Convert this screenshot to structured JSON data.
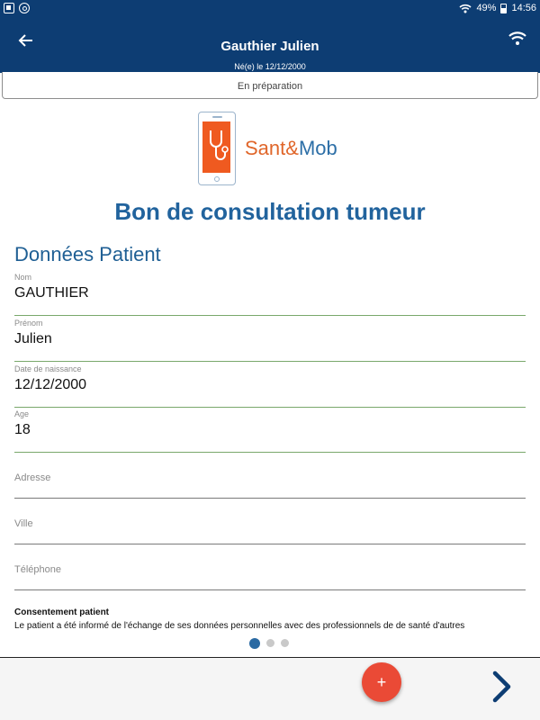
{
  "status_bar": {
    "battery": "49%",
    "time": "14:56",
    "icons": [
      "notification-icon",
      "sync-icon",
      "wifi-icon",
      "battery-icon"
    ]
  },
  "header": {
    "title": "Gauthier Julien",
    "subtitle": "Né(e) le 12/12/2000",
    "back_icon": "arrow-left-icon",
    "wifi_icon": "wifi-icon",
    "color": "#0d3d73"
  },
  "status_strip": {
    "label": "En préparation"
  },
  "logo": {
    "word1": "Sant&",
    "word2": "Mob",
    "screen_color": "#ef5a20"
  },
  "document_title": "Bon de consultation tumeur",
  "section_title": "Données Patient",
  "fields": [
    {
      "label": "Nom",
      "value": "GAUTHIER"
    },
    {
      "label": "Prénom",
      "value": "Julien"
    },
    {
      "label": "Date de naissance",
      "value": "12/12/2000"
    },
    {
      "label": "Age",
      "value": "18"
    },
    {
      "placeholder": "Adresse"
    },
    {
      "placeholder": "Ville"
    },
    {
      "placeholder": "Téléphone"
    }
  ],
  "consent": {
    "title": "Consentement patient",
    "text": "Le patient a été informé de l'échange de ses données personnelles avec des professionnels de de santé d'autres"
  },
  "pagination": {
    "pages": 3,
    "current": 1
  },
  "bottom": {
    "fab_label": "+",
    "fab_color": "#ea4a36",
    "next_icon": "chevron-right-icon"
  }
}
